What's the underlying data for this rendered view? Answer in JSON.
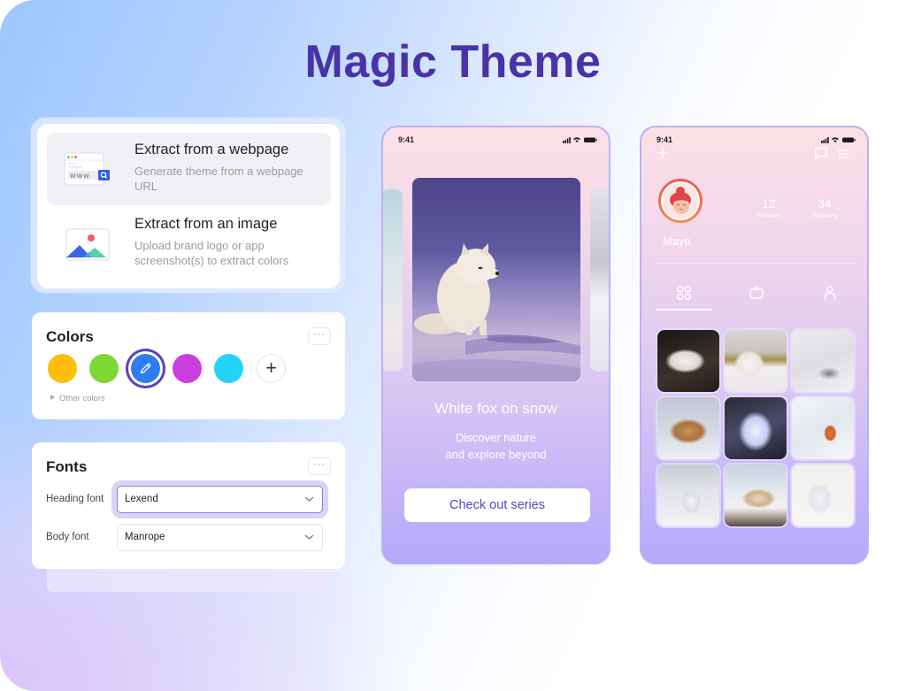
{
  "page": {
    "title": "Magic Theme"
  },
  "extract": {
    "options": [
      {
        "title": "Extract from a webpage",
        "description": "Generate theme from a webpage URL",
        "icon": "browser-www-search-icon",
        "active": true
      },
      {
        "title": "Extract from an image",
        "description": "Upload brand logo or app screenshot(s) to extract colors",
        "icon": "image-mountain-icon",
        "active": false
      }
    ],
    "webpage_icon_text": "www"
  },
  "colors": {
    "title": "Colors",
    "more_label": "···",
    "swatches": [
      {
        "hex": "#FFBE0B",
        "selected": false
      },
      {
        "hex": "#7ED832",
        "selected": false
      },
      {
        "hex": "#2F7CF0",
        "selected": true
      },
      {
        "hex": "#C93EDF",
        "selected": false
      },
      {
        "hex": "#22D3FA",
        "selected": false
      }
    ],
    "add_label": "+",
    "other_colors_label": "Other colors"
  },
  "fonts": {
    "title": "Fonts",
    "more_label": "···",
    "rows": [
      {
        "label": "Heading font",
        "value": "Lexend",
        "focused": true
      },
      {
        "label": "Body font",
        "value": "Manrope",
        "focused": false
      }
    ]
  },
  "phone1": {
    "time": "9:41",
    "hero_title": "White fox on snow",
    "subtitle_line1": "Discover nature",
    "subtitle_line2": "and explore beyond",
    "cta_label": "Check out series"
  },
  "phone2": {
    "time": "9:41",
    "profile_name": "Maya",
    "stats": [
      {
        "value": "12",
        "label": "Follower"
      },
      {
        "value": "34",
        "label": "Following"
      }
    ],
    "tabs": [
      {
        "icon": "grid-icon",
        "active": true
      },
      {
        "icon": "tv-icon",
        "active": false
      },
      {
        "icon": "person-icon",
        "active": false
      }
    ],
    "gallery": [
      {
        "alt": "White fox curled on dark rocks"
      },
      {
        "alt": "White fox sitting in front of house"
      },
      {
        "alt": "White fluffy fox lying in snow"
      },
      {
        "alt": "Orange fox curled up in snow"
      },
      {
        "alt": "White fox close-up in forest"
      },
      {
        "alt": "Red fox walking in deep snow"
      },
      {
        "alt": "White fox sitting under snowy tree"
      },
      {
        "alt": "Fox walking on snowy ledge"
      },
      {
        "alt": "White fox in pale snowy field"
      }
    ]
  },
  "theme_colors": {
    "title": "#4A33A8",
    "accent": "#5B3FC9",
    "phone_border": "#BCB0F7",
    "cta_text": "#5A43C6"
  }
}
